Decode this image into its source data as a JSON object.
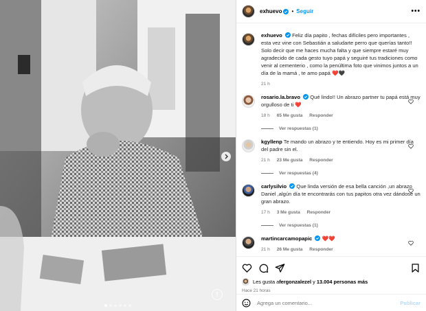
{
  "post": {
    "username": "exhuevo",
    "follow_label": "Seguir",
    "more": "•••",
    "caption": "Feliz día papito , fechas difíciles pero importantes , esta vez vine con Sebastián a saludarte perro que querías tanto!! Solo decir que me haces mucha falta y que siempre estaré muy agradecido de cada gesto tuyo papá y seguiré tus tradiciones como venir al cementerio , como la penúltima foto que vinimos juntos a un día de la mamá , te amo papá ❤️🖤",
    "caption_time": "21 h"
  },
  "comments": [
    {
      "user": "rosario.la.bravo",
      "verified": true,
      "text": "Qué lindo!! Un abrazo partner tu papá está muy orgulloso de ti ❤️",
      "time": "18 h",
      "likes": "65 Me gusta",
      "reply": "Responder",
      "view_replies": "Ver respuestas (1)"
    },
    {
      "user": "kgyllenp",
      "verified": false,
      "text": "Te mando un abrazo y te entiendo. Hoy es mi primer día del padre sin el.",
      "time": "21 h",
      "likes": "23 Me gusta",
      "reply": "Responder",
      "view_replies": "Ver respuestas (4)"
    },
    {
      "user": "carlysilvio",
      "verified": true,
      "text": "Que linda versión de esa bella canción ,un abrazo Daniel ,algún día te encontrarás con tus papitos otra vez dándose un gran abrazo.",
      "time": "17 h",
      "likes": "3 Me gusta",
      "reply": "Responder",
      "view_replies": "Ver respuestas (1)"
    },
    {
      "user": "martincarcamopapic",
      "verified": true,
      "text": "❤️❤️",
      "time": "21 h",
      "likes": "26 Me gusta",
      "reply": "Responder",
      "view_replies": ""
    }
  ],
  "footer": {
    "likes_prefix": "Les gusta a ",
    "likes_user": "fergonzalezel",
    "likes_mid": " y ",
    "likes_count": "13.004 personas más",
    "time": "Hace 21 horas",
    "add_comment_placeholder": "Agrega un comentario...",
    "publish": "Publicar"
  },
  "photo": {
    "alt_badge": "!",
    "slide_count": 6,
    "active_slide": 1
  },
  "colors": {
    "link_blue": "#0095f6",
    "muted": "#737373",
    "heart_red": "#ff3040",
    "verified_blue": "#0095f6"
  }
}
